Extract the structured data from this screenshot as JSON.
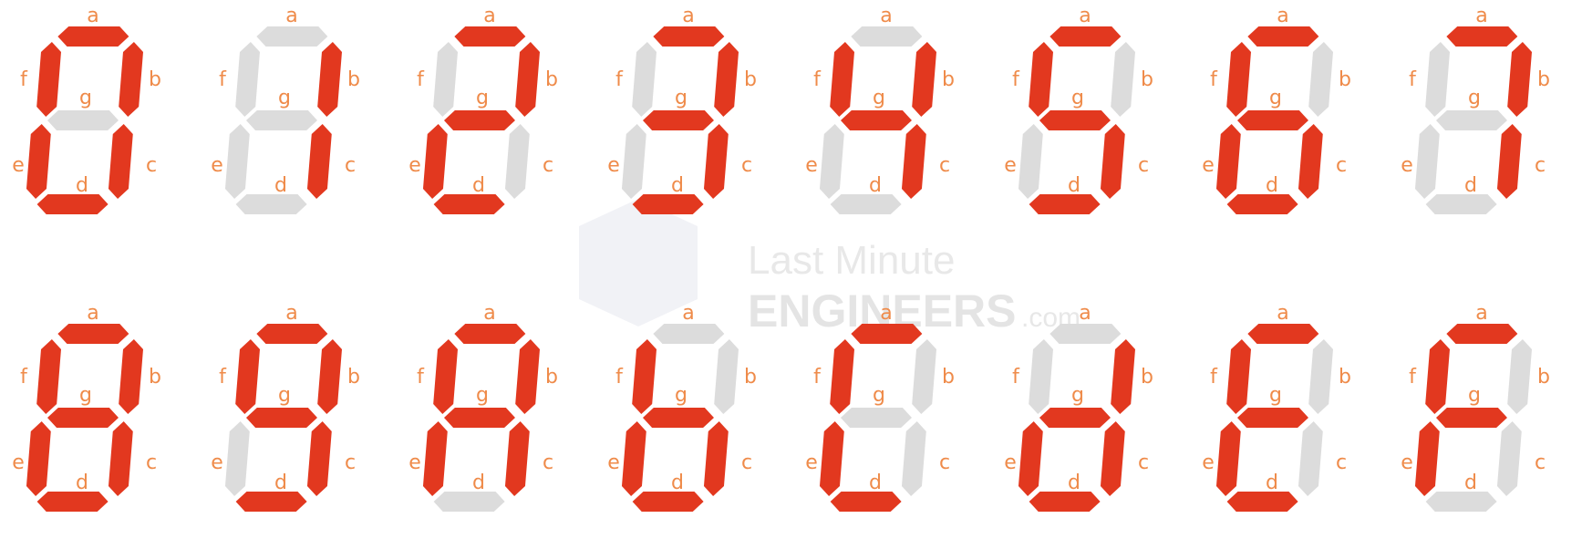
{
  "segment_labels": {
    "a": "a",
    "b": "b",
    "c": "c",
    "d": "d",
    "e": "e",
    "f": "f",
    "g": "g"
  },
  "colors": {
    "on": "#e2381f",
    "off": "#dcdcdc",
    "label": "#ef8b4a"
  },
  "watermark": {
    "line1": "Last Minute",
    "line2": "ENGINEERS",
    "suffix": ".com"
  },
  "digits": [
    {
      "segments_on": [
        "a",
        "b",
        "c",
        "d",
        "e",
        "f"
      ]
    },
    {
      "segments_on": [
        "b",
        "c"
      ]
    },
    {
      "segments_on": [
        "a",
        "b",
        "g",
        "e",
        "d"
      ]
    },
    {
      "segments_on": [
        "a",
        "b",
        "g",
        "c",
        "d"
      ]
    },
    {
      "segments_on": [
        "f",
        "g",
        "b",
        "c"
      ]
    },
    {
      "segments_on": [
        "a",
        "f",
        "g",
        "c",
        "d"
      ]
    },
    {
      "segments_on": [
        "a",
        "f",
        "g",
        "e",
        "d",
        "c"
      ]
    },
    {
      "segments_on": [
        "a",
        "b",
        "c"
      ]
    },
    {
      "segments_on": [
        "a",
        "b",
        "c",
        "d",
        "e",
        "f",
        "g"
      ]
    },
    {
      "segments_on": [
        "a",
        "b",
        "c",
        "d",
        "f",
        "g"
      ]
    },
    {
      "segments_on": [
        "a",
        "b",
        "c",
        "e",
        "f",
        "g"
      ]
    },
    {
      "segments_on": [
        "f",
        "e",
        "g",
        "c",
        "d"
      ]
    },
    {
      "segments_on": [
        "a",
        "f",
        "e",
        "d"
      ]
    },
    {
      "segments_on": [
        "b",
        "c",
        "g",
        "e",
        "d"
      ]
    },
    {
      "segments_on": [
        "a",
        "f",
        "g",
        "e",
        "d"
      ]
    },
    {
      "segments_on": [
        "a",
        "f",
        "g",
        "e"
      ]
    }
  ]
}
